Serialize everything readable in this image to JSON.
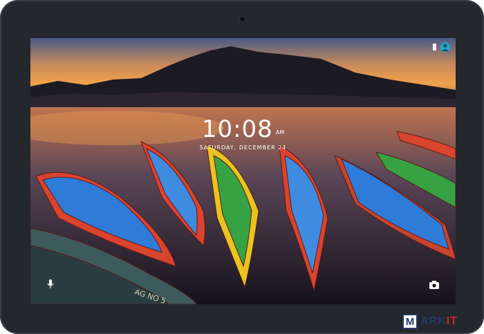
{
  "lockscreen": {
    "time": "10:08",
    "ampm": "AM",
    "date": "SATURDAY, DECEMBER 24"
  },
  "status_bar": {
    "icons": [
      "battery-icon",
      "user-avatar-icon"
    ]
  },
  "shortcuts": {
    "left": "microphone-icon",
    "right": "camera-icon"
  },
  "wallpaper": {
    "boat_lettering": "AG NO 5"
  },
  "watermark": {
    "logo_letter": "M",
    "text_main": "ARK",
    "text_accent": "IT"
  },
  "colors": {
    "bezel": "#24272c",
    "accent_avatar": "#21a7c9",
    "watermark_blue": "#233a6d",
    "watermark_red": "#d32027"
  }
}
